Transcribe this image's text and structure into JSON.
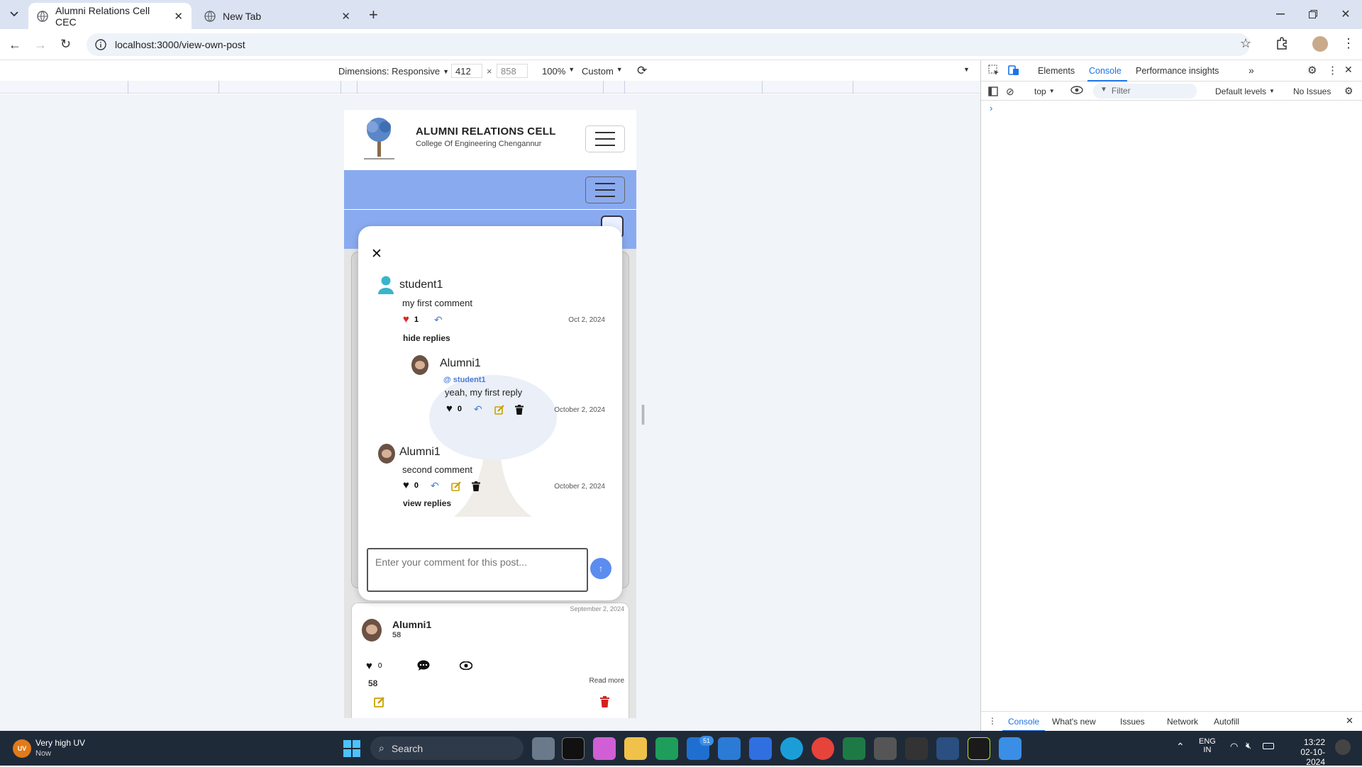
{
  "browser": {
    "tabs": [
      {
        "title": "Alumni Relations Cell CEC",
        "active": true
      },
      {
        "title": "New Tab",
        "active": false
      }
    ],
    "url": "localhost:3000/view-own-post"
  },
  "device_toolbar": {
    "dimensions_label": "Dimensions: Responsive",
    "width": "412",
    "height": "858",
    "zoom": "100%",
    "throttle": "Custom"
  },
  "site": {
    "title": "ALUMNI RELATIONS CELL",
    "subtitle": "College Of Engineering Chengannur"
  },
  "modal": {
    "comments": [
      {
        "author": "student1",
        "text": "my first comment",
        "likes": "1",
        "date": "Oct 2, 2024",
        "toggle_label": "hide replies",
        "replies": [
          {
            "author": "Alumni1",
            "mention": "@ student1",
            "text": "yeah, my first reply",
            "likes": "0",
            "date": "October 2, 2024"
          }
        ]
      },
      {
        "author": "Alumni1",
        "text": "second comment",
        "likes": "0",
        "date": "October 2, 2024",
        "toggle_label": "view replies"
      }
    ],
    "input_placeholder": "Enter your comment for this post..."
  },
  "post_card": {
    "date": "September 2, 2024",
    "author": "Alumni1",
    "sub": "58",
    "likes": "0",
    "body": "58",
    "read_more": "Read more"
  },
  "devtools": {
    "tabs": [
      "Elements",
      "Console",
      "Performance insights"
    ],
    "active_tab": "Console",
    "context": "top",
    "filter_placeholder": "Filter",
    "levels": "Default levels",
    "issues": "No Issues",
    "drawer_tabs": [
      "Console",
      "What's new",
      "Issues",
      "Network",
      "Autofill"
    ]
  },
  "taskbar": {
    "weather_title": "Very high UV",
    "weather_sub": "Now",
    "weather_badge": "UV",
    "search_label": "Search",
    "lang_top": "ENG",
    "lang_bottom": "IN",
    "time": "13:22",
    "date": "02-10-2024",
    "mail_badge": "51"
  },
  "colors": {
    "accent_blue": "#8aaaf0",
    "like_red": "#e02424",
    "send_button": "#5b8def",
    "taskbar": "#1f2a38"
  }
}
